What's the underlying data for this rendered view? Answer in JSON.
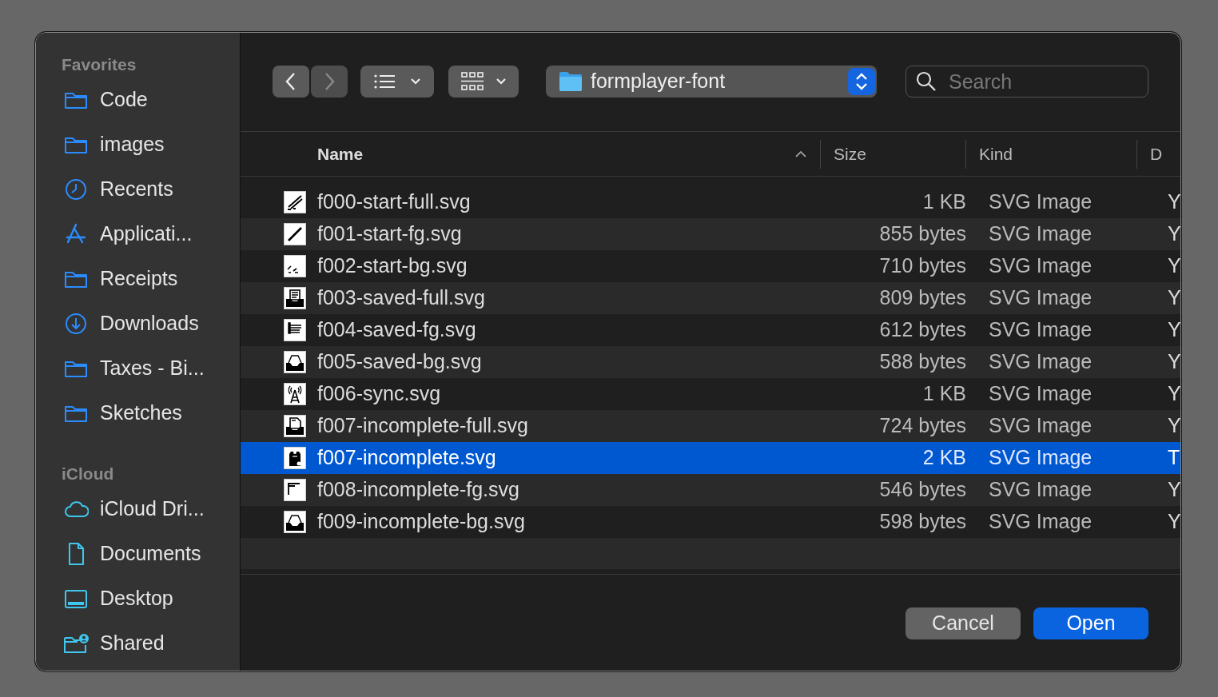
{
  "sidebar": [
    {
      "title": "Favorites",
      "items": [
        {
          "label": "Code",
          "kind": "folder"
        },
        {
          "label": "images",
          "kind": "folder"
        },
        {
          "label": "Recents",
          "kind": "clock"
        },
        {
          "label": "Applicati...",
          "kind": "apps"
        },
        {
          "label": "Receipts",
          "kind": "folder"
        },
        {
          "label": "Downloads",
          "kind": "download"
        },
        {
          "label": "Taxes - Bi...",
          "kind": "folder"
        },
        {
          "label": "Sketches",
          "kind": "folder"
        }
      ]
    },
    {
      "title": "iCloud",
      "items": [
        {
          "label": "iCloud Dri...",
          "kind": "cloud"
        },
        {
          "label": "Documents",
          "kind": "document"
        },
        {
          "label": "Desktop",
          "kind": "desktop"
        },
        {
          "label": "Shared",
          "kind": "shared"
        }
      ]
    }
  ],
  "toolbar": {
    "back": {
      "disabled": false
    },
    "forward": {
      "disabled": true
    },
    "location": "formplayer-font",
    "search": {
      "placeholder": "Search"
    }
  },
  "columns": [
    {
      "label": "Name",
      "sorted": true
    },
    {
      "label": "Size",
      "sorted": false
    },
    {
      "label": "Kind",
      "sorted": false
    },
    {
      "label": "D",
      "sorted": false
    }
  ],
  "rows": [
    {
      "name": "f000-start-full.svg",
      "size": "1 KB",
      "file_kind": "SVG Image",
      "column_4": "Y",
      "kind": "pens",
      "selected": false
    },
    {
      "name": "f001-start-fg.svg",
      "size": "855 bytes",
      "file_kind": "SVG Image",
      "column_4": "Y",
      "kind": "pen",
      "selected": false
    },
    {
      "name": "f002-start-bg.svg",
      "size": "710 bytes",
      "file_kind": "SVG Image",
      "column_4": "Y",
      "kind": "dashes",
      "selected": false
    },
    {
      "name": "f003-saved-full.svg",
      "size": "809 bytes",
      "file_kind": "SVG Image",
      "column_4": "Y",
      "kind": "traydoc",
      "selected": false
    },
    {
      "name": "f004-saved-fg.svg",
      "size": "612 bytes",
      "file_kind": "SVG Image",
      "column_4": "Y",
      "kind": "doclines",
      "selected": false
    },
    {
      "name": "f005-saved-bg.svg",
      "size": "588 bytes",
      "file_kind": "SVG Image",
      "column_4": "Y",
      "kind": "tray",
      "selected": false
    },
    {
      "name": "f006-sync.svg",
      "size": "1 KB",
      "file_kind": "SVG Image",
      "column_4": "Y",
      "kind": "antenna",
      "selected": false
    },
    {
      "name": "f007-incomplete-full.svg",
      "size": "724 bytes",
      "file_kind": "SVG Image",
      "column_4": "Y",
      "kind": "traypage",
      "selected": false
    },
    {
      "name": "f007-incomplete.svg",
      "size": "2 KB",
      "file_kind": "SVG Image",
      "column_4": "T",
      "kind": "tag",
      "selected": true
    },
    {
      "name": "f008-incomplete-fg.svg",
      "size": "546 bytes",
      "file_kind": "SVG Image",
      "column_4": "Y",
      "kind": "corner",
      "selected": false
    },
    {
      "name": "f009-incomplete-bg.svg",
      "size": "598 bytes",
      "file_kind": "SVG Image",
      "column_4": "Y",
      "kind": "tray",
      "selected": false
    }
  ],
  "buttons": [
    {
      "label": "Cancel",
      "kind": "default"
    },
    {
      "label": "Open",
      "kind": "primary"
    }
  ]
}
